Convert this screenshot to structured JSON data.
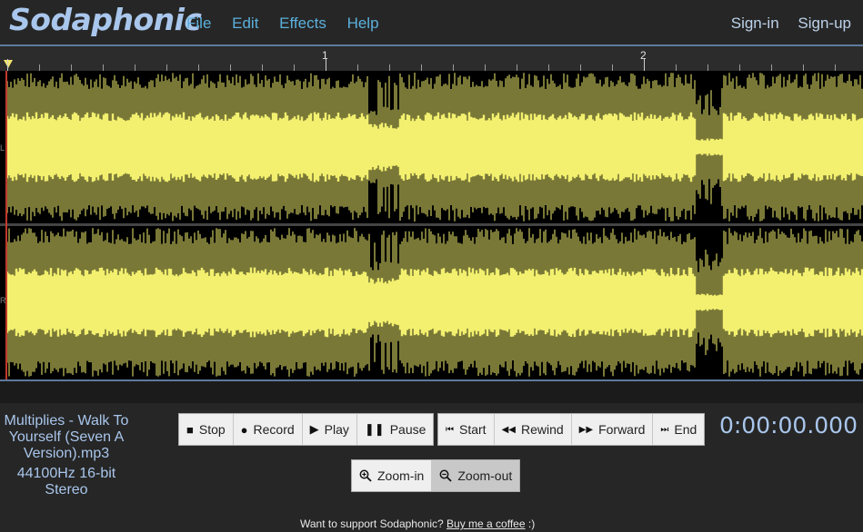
{
  "app": {
    "name": "Sodaphonic"
  },
  "menu": {
    "left": [
      "File",
      "Edit",
      "Effects",
      "Help"
    ],
    "right": [
      "Sign-in",
      "Sign-up"
    ]
  },
  "ruler": {
    "labels": [
      "1",
      "2"
    ]
  },
  "waveform": {
    "channels": [
      "L",
      "R"
    ],
    "color": "#f2f06e"
  },
  "file": {
    "name": "Multiplies - Walk To Yourself (Seven A Version).mp3",
    "format": "44100Hz 16-bit Stereo"
  },
  "transport": {
    "stop": "Stop",
    "record": "Record",
    "play": "Play",
    "pause": "Pause",
    "start": "Start",
    "rewind": "Rewind",
    "forward": "Forward",
    "end": "End"
  },
  "zoom": {
    "in": "Zoom-in",
    "out": "Zoom-out"
  },
  "time": "0:00:00.000",
  "support": {
    "text": "Want to support Sodaphonic?",
    "link": "Buy me a coffee",
    "suffix": ":)"
  }
}
